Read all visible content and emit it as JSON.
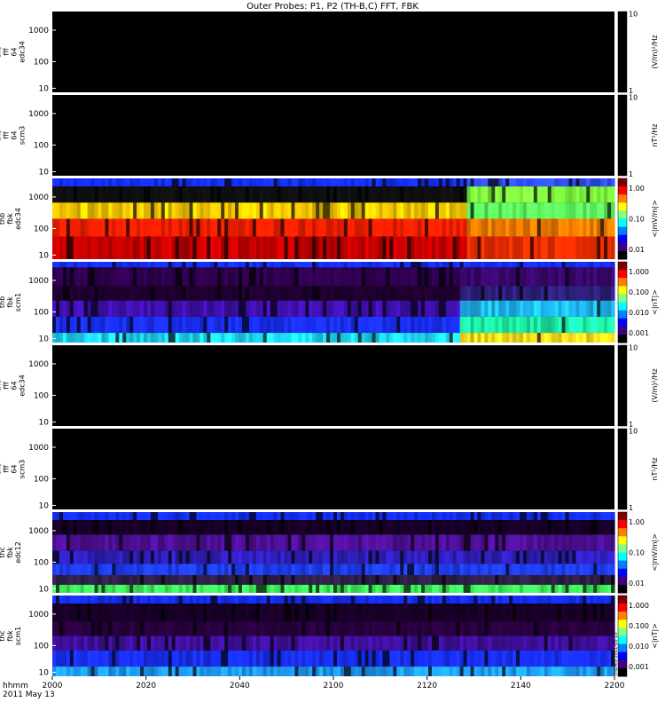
{
  "title": "Outer Probes: P1, P2 (TH-B,C) FFT, FBK",
  "footer": {
    "label1": "hhmm",
    "label2": "2011 May 13"
  },
  "xaxis": {
    "range": [
      "2000",
      "2200"
    ],
    "ticks": [
      "2000",
      "2020",
      "2040",
      "2100",
      "2120",
      "2140",
      "2200"
    ],
    "tick_minutes": [
      0,
      20,
      40,
      60,
      80,
      100,
      120
    ]
  },
  "stamp_text": "THEMIS 2011-05-13",
  "colors": {
    "background": "#000000",
    "separator": "#ffffff"
  },
  "chart_data": [
    {
      "type": "heatmap",
      "probe": "thb",
      "ylabel": [
        "thb",
        "fff",
        "64",
        "edc34"
      ],
      "yticks": [
        "1000",
        "100",
        "10"
      ],
      "ylog": true,
      "colorbar": {
        "ticks": [
          "10",
          "1"
        ],
        "unit": "(V/m)²/Hz"
      },
      "data_state": "empty"
    },
    {
      "type": "heatmap",
      "probe": "thb",
      "ylabel": [
        "thb",
        "fff",
        "64",
        "scm3"
      ],
      "yticks": [
        "1000",
        "100",
        "10"
      ],
      "ylog": true,
      "colorbar": {
        "ticks": [
          "10",
          "1"
        ],
        "unit": "nT²/Hz"
      },
      "data_state": "empty"
    },
    {
      "type": "heatmap",
      "probe": "thb",
      "ylabel": [
        "thb",
        "fbk",
        "edc34"
      ],
      "yticks": [
        "1000",
        "100",
        "10"
      ],
      "ylog": true,
      "colorbar": {
        "ticks": [
          "1.00",
          "0.10",
          "0.01"
        ],
        "unit": "<|mV/m|>"
      },
      "data_state": "filled",
      "bands": [
        {
          "rows": [
            "#1530ff",
            "#101010",
            "#ffd000",
            "#ff2000",
            "#c80000"
          ],
          "stops": [
            0.0,
            0.1,
            0.3,
            0.5,
            0.72,
            1.0
          ],
          "after_change": [
            "#3050ff",
            "#80ff40",
            "#60ff60",
            "#ff8000",
            "#ff3000"
          ]
        }
      ],
      "change_minute": 88
    },
    {
      "type": "heatmap",
      "probe": "thb",
      "ylabel": [
        "thb",
        "fbk",
        "scm1"
      ],
      "yticks": [
        "1000",
        "100",
        "10"
      ],
      "ylog": true,
      "colorbar": {
        "ticks": [
          "1.000",
          "0.100",
          "0.010",
          "0.001"
        ],
        "unit": "<|nT|>"
      },
      "data_state": "filled",
      "bands": [
        {
          "rows": [
            "#1530ff",
            "#300050",
            "#200030",
            "#4010b0",
            "#1a30ff",
            "#20e0ff"
          ],
          "stops": [
            0.0,
            0.07,
            0.3,
            0.48,
            0.68,
            0.88,
            1.0
          ],
          "after_change": [
            "#1530ff",
            "#3a0870",
            "#302080",
            "#20c0ff",
            "#20ffb0",
            "#ffe020"
          ]
        }
      ],
      "change_minute": 87
    },
    {
      "type": "heatmap",
      "probe": "thc",
      "ylabel": [
        "thc",
        "fff",
        "64",
        "edc34"
      ],
      "yticks": [
        "1000",
        "100",
        "10"
      ],
      "ylog": true,
      "colorbar": {
        "ticks": [
          "10",
          "1"
        ],
        "unit": "(V/m)²/Hz"
      },
      "data_state": "empty"
    },
    {
      "type": "heatmap",
      "probe": "thc",
      "ylabel": [
        "thc",
        "fff",
        "64",
        "scm3"
      ],
      "yticks": [
        "1000",
        "100",
        "10"
      ],
      "ylog": true,
      "colorbar": {
        "ticks": [
          "10",
          "1"
        ],
        "unit": "nT²/Hz"
      },
      "data_state": "empty"
    },
    {
      "type": "heatmap",
      "probe": "thc",
      "ylabel": [
        "thc",
        "fbk",
        "edc12"
      ],
      "yticks": [
        "1000",
        "100",
        "10"
      ],
      "ylog": true,
      "colorbar": {
        "ticks": [
          "1.00",
          "0.10",
          "0.01"
        ],
        "unit": "<|mV/m|>"
      },
      "data_state": "filled",
      "bands": [
        {
          "rows": [
            "#1530ff",
            "#180028",
            "#50109a",
            "#3020c0",
            "#2040ff",
            "#30204a",
            "#40ff60"
          ],
          "stops": [
            0.0,
            0.1,
            0.28,
            0.48,
            0.64,
            0.78,
            0.9,
            1.0
          ],
          "after_change": null
        }
      ],
      "change_minute": null
    },
    {
      "type": "heatmap",
      "probe": "thc",
      "ylabel": [
        "thc",
        "fbk",
        "scm1"
      ],
      "yticks": [
        "1000",
        "100",
        "10"
      ],
      "ylog": true,
      "colorbar": {
        "ticks": [
          "1.000",
          "0.100",
          "0.010",
          "0.001"
        ],
        "unit": "<|nT|>"
      },
      "data_state": "filled",
      "bands": [
        {
          "rows": [
            "#1530ff",
            "#180028",
            "#2a0040",
            "#4010a0",
            "#1a30ff",
            "#20a0ff"
          ],
          "stops": [
            0.0,
            0.1,
            0.32,
            0.5,
            0.68,
            0.88,
            1.0
          ],
          "after_change": null
        }
      ],
      "change_minute": null
    }
  ]
}
